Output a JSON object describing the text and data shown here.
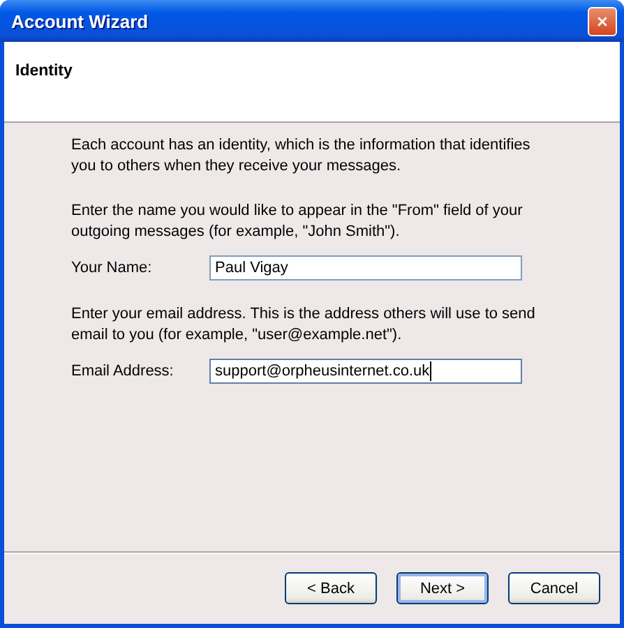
{
  "window": {
    "title": "Account Wizard"
  },
  "page": {
    "heading": "Identity"
  },
  "paragraphs": [
    "Each account has an identity, which is the information that identifies you to others when they receive your messages."
  ],
  "fields": [
    {
      "intro": "Enter the name you would like to appear in the \"From\" field of your outgoing messages (for example, \"John Smith\").",
      "label": "Your Name:",
      "value": "Paul Vigay",
      "focused": false
    },
    {
      "intro": "Enter your email address. This is the address others will use to send email to you (for example, \"user@example.net\").",
      "label": "Email Address:",
      "value": "support@orpheusinternet.co.uk",
      "focused": true
    }
  ],
  "buttons": [
    {
      "label": "< Back",
      "default": false
    },
    {
      "label": "Next >",
      "default": true
    },
    {
      "label": "Cancel",
      "default": false
    }
  ]
}
